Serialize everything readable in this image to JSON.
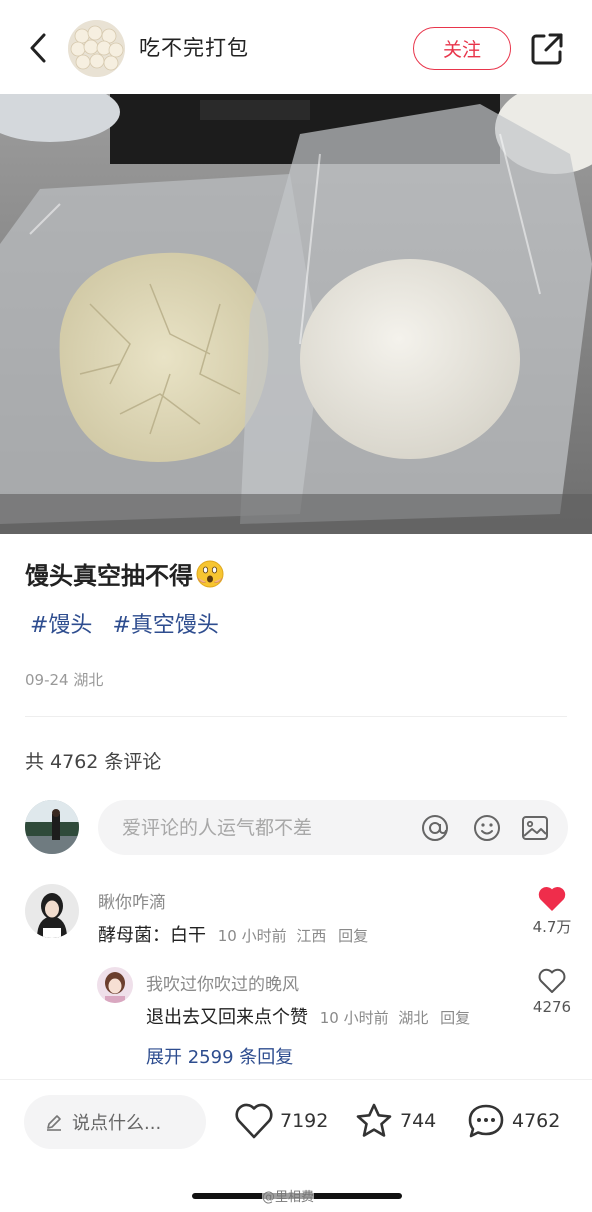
{
  "header": {
    "author_name": "吃不完打包",
    "follow_label": "关注"
  },
  "post": {
    "title": "馒头真空抽不得",
    "tags": [
      "#馒头",
      "#真空馒头"
    ],
    "date": "09-24",
    "location": "湖北"
  },
  "comments": {
    "total_label": "共 4762 条评论",
    "input_placeholder": "爱评论的人运气都不差",
    "items": [
      {
        "name": "瞅你咋滴",
        "text": "酵母菌：白干",
        "time": "10 小时前",
        "location": "江西",
        "reply_label": "回复",
        "likes": "4.7万",
        "liked": true
      },
      {
        "name": "我吹过你吹过的晚风",
        "text": "退出去又回来点个赞",
        "time": "10 小时前",
        "location": "湖北",
        "reply_label": "回复",
        "likes": "4276",
        "liked": false
      }
    ],
    "expand_label": "展开 2599 条回复"
  },
  "bottom_bar": {
    "say_placeholder": "说点什么...",
    "likes": "7192",
    "stars": "744",
    "comments": "4762"
  },
  "watermark": "@里相费",
  "colors": {
    "accent": "#e8354b",
    "tag_blue": "#2e4d8f",
    "muted": "#999999"
  }
}
